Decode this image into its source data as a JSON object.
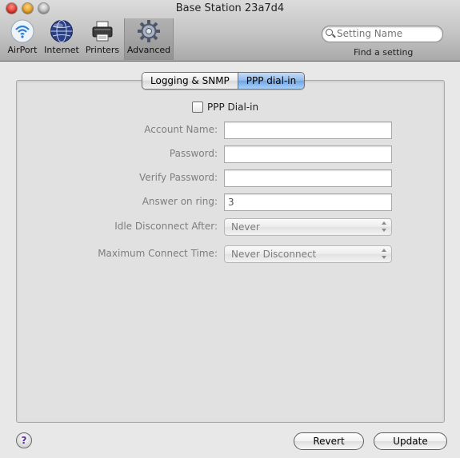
{
  "window": {
    "title": "Base Station 23a7d4"
  },
  "toolbar": {
    "items": [
      {
        "label": "AirPort",
        "icon": "wifi-icon"
      },
      {
        "label": "Internet",
        "icon": "globe-icon"
      },
      {
        "label": "Printers",
        "icon": "printer-icon"
      },
      {
        "label": "Advanced",
        "icon": "gear-icon",
        "selected": true
      }
    ],
    "search_placeholder": "Setting Name",
    "find_label": "Find a setting"
  },
  "tabs": [
    {
      "label": "Logging & SNMP",
      "active": false
    },
    {
      "label": "PPP dial-in",
      "active": true
    }
  ],
  "form": {
    "ppp_checkbox_label": "PPP Dial-in",
    "ppp_checked": false,
    "account_name_label": "Account Name:",
    "account_name_value": "",
    "password_label": "Password:",
    "password_value": "",
    "verify_password_label": "Verify Password:",
    "verify_password_value": "",
    "answer_on_ring_label": "Answer on ring:",
    "answer_on_ring_value": "3",
    "idle_disconnect_label": "Idle Disconnect After:",
    "idle_disconnect_value": "Never",
    "max_connect_label": "Maximum Connect Time:",
    "max_connect_value": "Never Disconnect"
  },
  "footer": {
    "help_label": "?",
    "revert_label": "Revert",
    "update_label": "Update"
  },
  "colors": {
    "tab_active": "#8fb9ec",
    "help_mark": "#5b2aa1",
    "close": "#d32a1e",
    "minimize": "#d99318"
  }
}
